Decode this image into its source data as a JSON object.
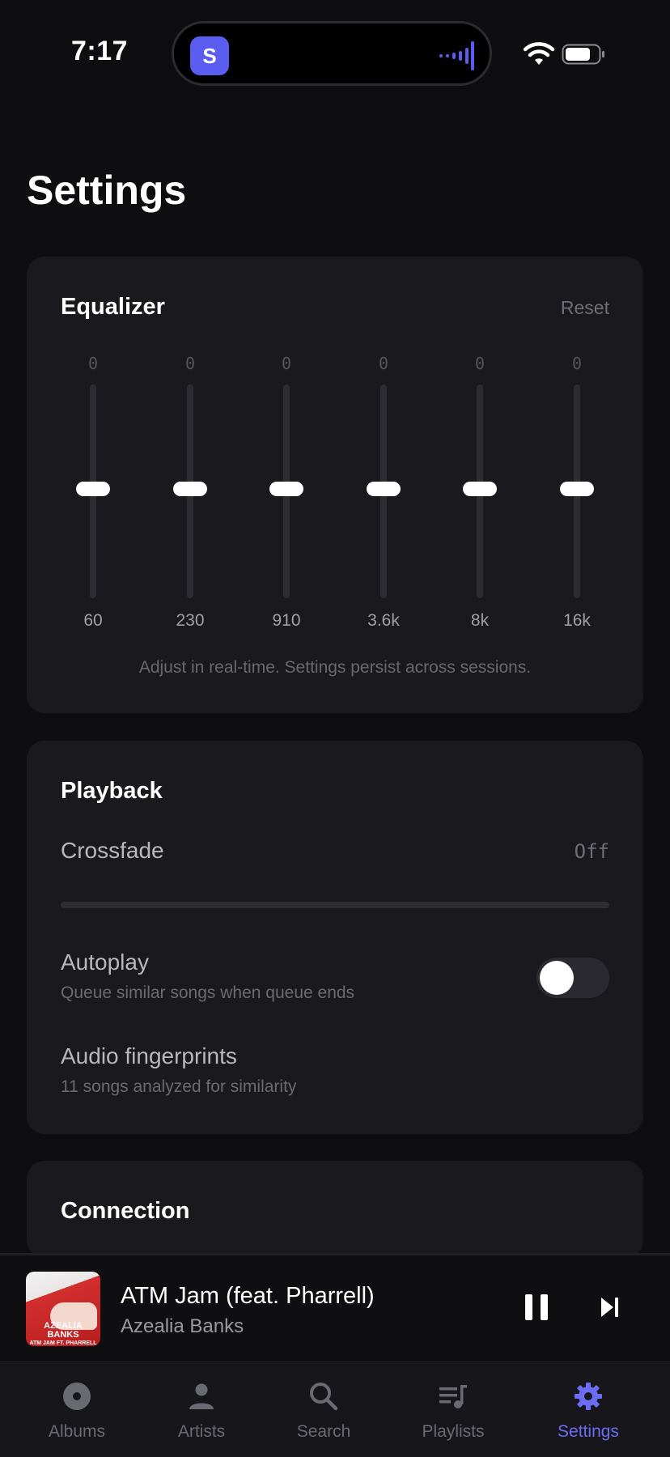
{
  "status_bar": {
    "time": "7:17",
    "island_app_letter": "S",
    "accent_color": "#5b5cf0"
  },
  "page": {
    "title": "Settings"
  },
  "equalizer": {
    "title": "Equalizer",
    "reset_label": "Reset",
    "bands": [
      {
        "value": "0",
        "label": "60",
        "gain": 0
      },
      {
        "value": "0",
        "label": "230",
        "gain": 0
      },
      {
        "value": "0",
        "label": "910",
        "gain": 0
      },
      {
        "value": "0",
        "label": "3.6k",
        "gain": 0
      },
      {
        "value": "0",
        "label": "8k",
        "gain": 0
      },
      {
        "value": "0",
        "label": "16k",
        "gain": 0
      }
    ],
    "note": "Adjust in real-time. Settings persist across sessions."
  },
  "playback": {
    "title": "Playback",
    "crossfade_label": "Crossfade",
    "crossfade_value": "Off",
    "autoplay_label": "Autoplay",
    "autoplay_sub": "Queue similar songs when queue ends",
    "autoplay_on": false,
    "fingerprints_label": "Audio fingerprints",
    "fingerprints_sub": "11 songs analyzed for similarity"
  },
  "connection": {
    "title": "Connection"
  },
  "mini_player": {
    "track_title": "ATM Jam (feat. Pharrell)",
    "artist": "Azealia Banks",
    "art_text": "AZEALIA BANKS",
    "art_sub": "ATM JAM FT. PHARRELL"
  },
  "tabs": [
    {
      "label": "Albums",
      "icon": "disc-icon"
    },
    {
      "label": "Artists",
      "icon": "person-icon"
    },
    {
      "label": "Search",
      "icon": "search-icon"
    },
    {
      "label": "Playlists",
      "icon": "playlist-icon"
    },
    {
      "label": "Settings",
      "icon": "gear-icon",
      "active": true
    }
  ]
}
